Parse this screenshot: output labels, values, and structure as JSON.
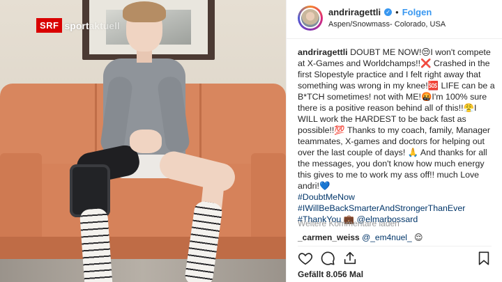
{
  "broadcaster": {
    "logo_srf": "SRF",
    "logo_sport": "sport",
    "logo_faded": "aktuell"
  },
  "post": {
    "username": "andriragettli",
    "follow_label": "Folgen",
    "dot": "•",
    "location": "Aspen/Snowmass- Colorado, USA",
    "caption_user": "andriragettli",
    "caption_text": "DOUBT ME NOW!😒I won't compete at X-Games and Worldchamps!!❌ Crashed in the first Slopestyle practice and I felt right away that something was wrong in my knee!🆘 LIFE can be a B*TCH sometimes! not with ME!🤬I'm 100% sure there is a positive reason behind all of this!!😤I WILL work the HARDEST to be back fast as possible!!💯 Thanks to my coach, family, Manager teammates, X-games and doctors for helping out over the last couple of days! 🙏 And thanks for all the messages, you don't know how much energy this gives to me to work my ass off!! much Love andri!💙",
    "hashtags": [
      "#DoubtMeNow",
      "#IWillBeBackSmarterAndStrongerThanEver",
      "#ThankYou"
    ],
    "thankyou_emoji": "💼",
    "mention_after_tags": "@elmarbossard",
    "load_more_label": "Weitere Kommentare laden",
    "comment": {
      "user": "_carmen_weiss",
      "mention": "@_em4nuel_",
      "emoji": "😌"
    },
    "likes_text": "Gefällt 8.056 Mal"
  },
  "icons": {
    "like": "heart-icon",
    "comment": "comment-icon",
    "share": "share-icon",
    "save": "bookmark-icon",
    "verified": "verified-badge-icon"
  },
  "colors": {
    "accent": "#3897f0",
    "srf_red": "#d90000",
    "hashtag": "#003569"
  }
}
